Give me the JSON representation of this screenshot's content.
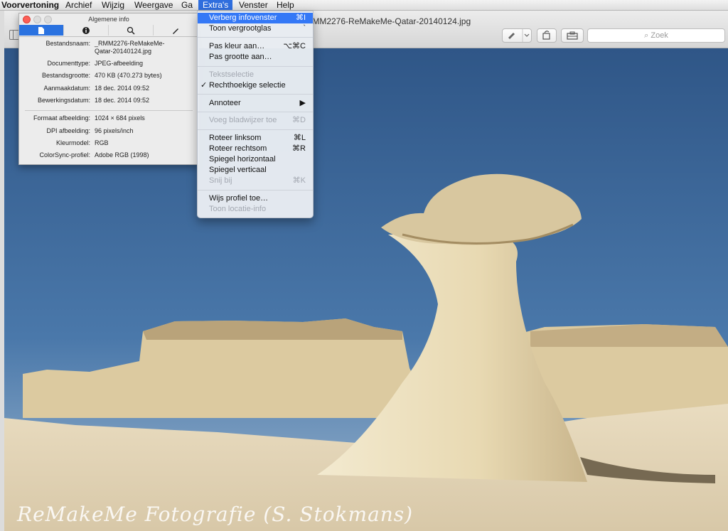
{
  "menubar": {
    "app": "Voorvertoning",
    "items": [
      "Archief",
      "Wijzig",
      "Weergave",
      "Ga",
      "Extra's",
      "Venster",
      "Help"
    ]
  },
  "window": {
    "title": "_RMM2276-ReMakeMe-Qatar-20140124.jpg",
    "search_placeholder": "Zoek"
  },
  "info_panel": {
    "title": "Algemene info",
    "tab_icons": [
      "document-icon",
      "info-icon",
      "search-icon",
      "pencil-icon"
    ],
    "rows": [
      {
        "label": "Bestandsnaam:",
        "value": "_RMM2276-ReMakeMe-"
      },
      {
        "label": "",
        "value": "Qatar-20140124.jpg"
      },
      {
        "label": "Documenttype:",
        "value": "JPEG-afbeelding"
      },
      {
        "label": "Bestandsgrootte:",
        "value": "470 KB (470.273 bytes)"
      },
      {
        "label": "Aanmaakdatum:",
        "value": "18 dec. 2014 09:52"
      },
      {
        "label": "Bewerkingsdatum:",
        "value": "18 dec. 2014 09:52"
      },
      {
        "label": "Formaat afbeelding:",
        "value": "1024 × 684 pixels"
      },
      {
        "label": "DPI afbeelding:",
        "value": "96 pixels/inch"
      },
      {
        "label": "Kleurmodel:",
        "value": "RGB"
      },
      {
        "label": "ColorSync-profiel:",
        "value": "Adobe RGB (1998)"
      }
    ]
  },
  "extras_menu": {
    "items": [
      {
        "label": "Verberg infovenster",
        "shortcut": "⌘I"
      },
      {
        "label": "Toon vergrootglas",
        "shortcut": "`"
      },
      {
        "label": "Pas kleur aan…",
        "shortcut": "⌥⌘C"
      },
      {
        "label": "Pas grootte aan…",
        "shortcut": ""
      },
      {
        "label": "Tekstselectie",
        "shortcut": ""
      },
      {
        "label": "Rechthoekige selectie",
        "shortcut": ""
      },
      {
        "label": "Annoteer",
        "shortcut": "▶"
      },
      {
        "label": "Voeg bladwijzer toe",
        "shortcut": "⌘D"
      },
      {
        "label": "Roteer linksom",
        "shortcut": "⌘L"
      },
      {
        "label": "Roteer rechtsom",
        "shortcut": "⌘R"
      },
      {
        "label": "Spiegel horizontaal",
        "shortcut": ""
      },
      {
        "label": "Spiegel verticaal",
        "shortcut": ""
      },
      {
        "label": "Snij bij",
        "shortcut": "⌘K"
      },
      {
        "label": "Wijs profiel toe…",
        "shortcut": ""
      },
      {
        "label": "Toon locatie-info",
        "shortcut": ""
      }
    ],
    "check_mark": "✓"
  },
  "photo": {
    "watermark": "ReMakeMe Fotografie (S. Stokmans)",
    "sky_color": "#3d6596",
    "rock_color": "#e8dcb8"
  }
}
